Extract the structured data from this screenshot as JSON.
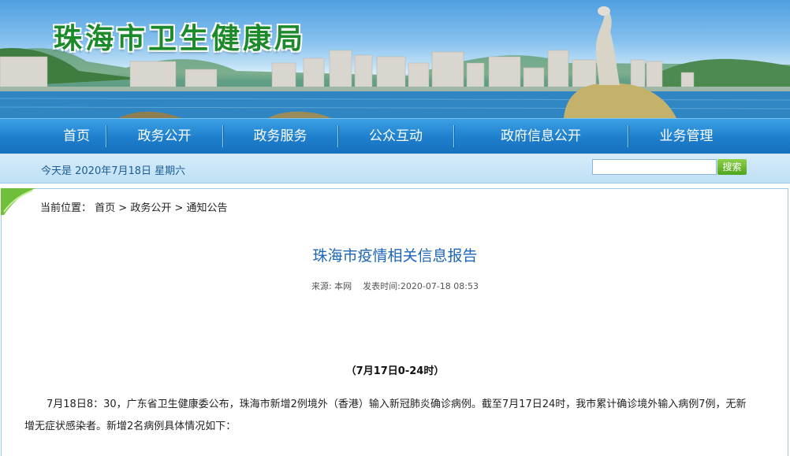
{
  "site": {
    "title": "珠海市卫生健康局"
  },
  "nav": {
    "items": [
      "首页",
      "政务公开",
      "政务服务",
      "公众互动",
      "政府信息公开",
      "业务管理"
    ]
  },
  "subbar": {
    "date": "今天是 2020年7月18日 星期六",
    "search_button": "搜索",
    "search_value": ""
  },
  "breadcrumb": {
    "label": "当前位置：",
    "items": [
      "首页",
      "政务公开",
      "通知公告"
    ],
    "separator": " > "
  },
  "article": {
    "title": "珠海市疫情相关信息报告",
    "source": "来源: 本网",
    "published": "发表时间:2020-07-18 08:53",
    "subhead": "（7月17日0-24时）",
    "paragraph": "7月18日8：30，广东省卫生健康委公布，珠海市新增2例境外（香港）输入新冠肺炎确诊病例。截至7月17日24时，我市累计确诊境外输入病例7例，无新增无症状感染者。新增2名病例具体情况如下："
  },
  "colors": {
    "title_green": "#1c8a2a",
    "nav_blue": "#1e7fcc",
    "article_title_blue": "#1c66b5",
    "search_green": "#4fa51e"
  }
}
